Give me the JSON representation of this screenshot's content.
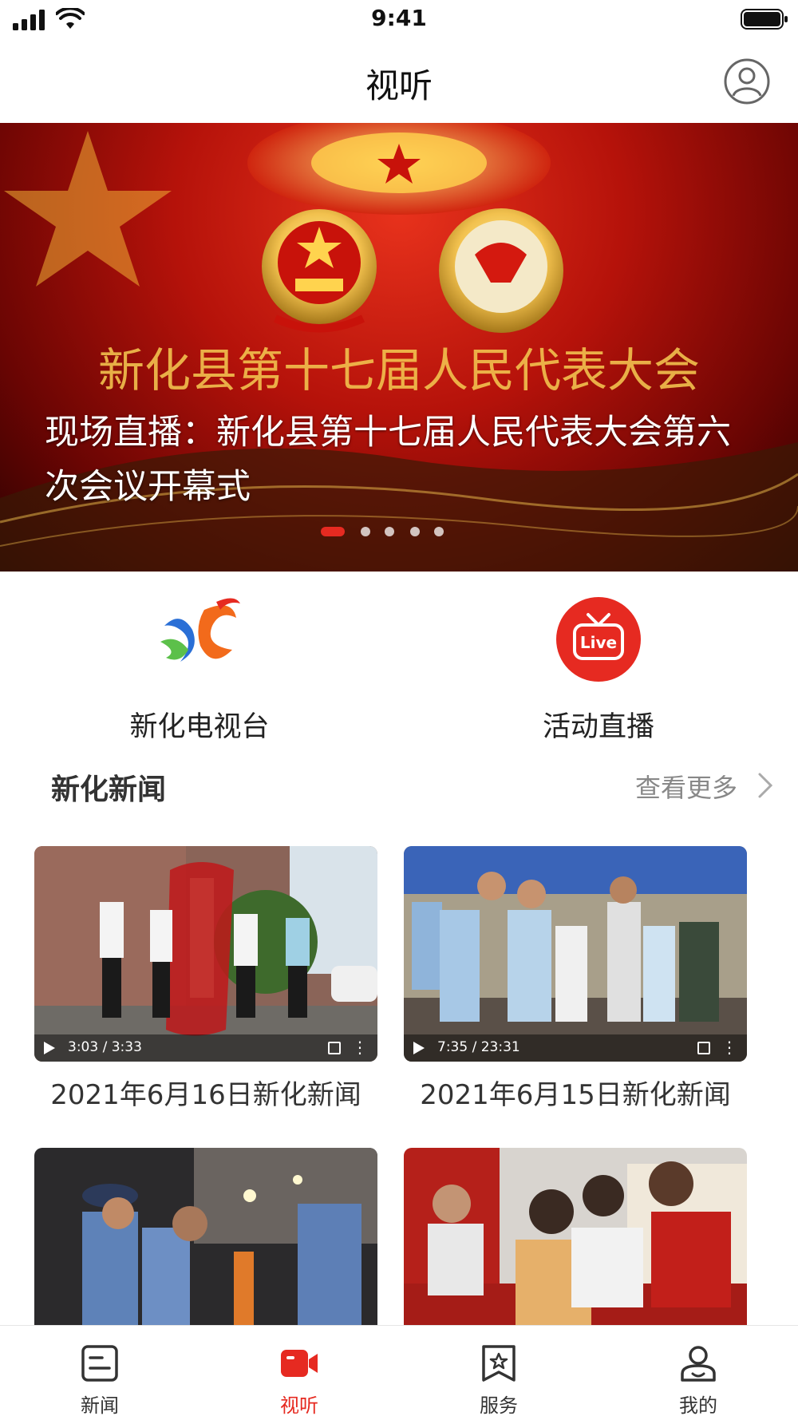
{
  "status_bar": {
    "time": "9:41"
  },
  "header": {
    "title": "视听"
  },
  "banner": {
    "caption": "现场直播：新化县第十七届人民代表大会第六次会议开幕式",
    "art_text": "新化县第十七届人民代表大会",
    "slide_count": 5,
    "active_slide": 1
  },
  "entries": [
    {
      "label": "新化电视台",
      "icon": "xinhua-tv-logo-icon"
    },
    {
      "label": "活动直播",
      "icon": "live-tv-icon",
      "badge": "Live"
    }
  ],
  "section": {
    "title": "新化新闻",
    "more_label": "查看更多"
  },
  "videos": [
    {
      "title": "2021年6月16日新化新闻",
      "time": "3:03 / 3:33"
    },
    {
      "title": "2021年6月15日新化新闻",
      "time": "7:35 / 23:31"
    },
    {
      "title": "",
      "time": ""
    },
    {
      "title": "",
      "time": ""
    }
  ],
  "tabbar": {
    "items": [
      {
        "label": "新闻",
        "icon": "news-icon"
      },
      {
        "label": "视听",
        "icon": "video-camera-icon",
        "active": true
      },
      {
        "label": "服务",
        "icon": "service-bookmark-icon"
      },
      {
        "label": "我的",
        "icon": "profile-icon"
      }
    ]
  },
  "colors": {
    "accent": "#e62a21",
    "banner_red": "#b5120a",
    "gold": "#f2c14e"
  }
}
